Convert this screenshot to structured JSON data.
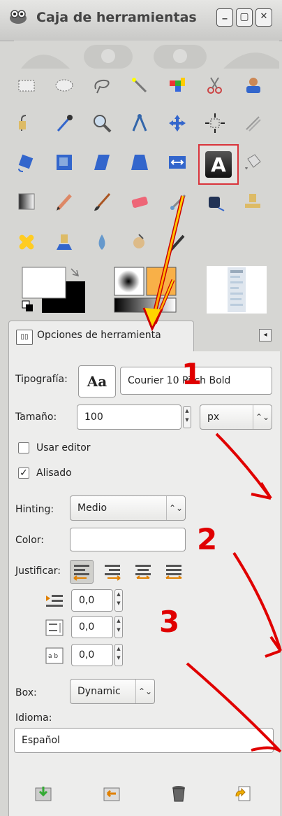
{
  "window": {
    "title": "Caja de herramientas"
  },
  "tab": {
    "label": "Opciones de herramienta"
  },
  "options": {
    "font_label": "Tipografía:",
    "font_button": "Aa",
    "font_value": "Courier 10 Pitch Bold",
    "size_label": "Tamaño:",
    "size_value": "100",
    "unit_value": "px",
    "use_editor_label": "Usar editor",
    "use_editor_checked": false,
    "antialias_label": "Alisado",
    "antialias_checked": true,
    "hinting_label": "Hinting:",
    "hinting_value": "Medio",
    "color_label": "Color:",
    "justify_label": "Justificar:",
    "indent_value": "0,0",
    "line_spacing_value": "0,0",
    "letter_spacing_value": "0,0",
    "box_label": "Box:",
    "box_value": "Dynamic",
    "language_label": "Idioma:",
    "language_value": "Español"
  },
  "annotations": [
    "1",
    "2",
    "3"
  ],
  "colors": {
    "annotation_red": "#e00000",
    "selection_box": "#d9343b",
    "foreground": "#ffffff",
    "background": "#000000",
    "pattern_orange": "#f8b048"
  },
  "icons": {
    "tools": [
      "rect-select-icon",
      "ellipse-select-icon",
      "free-select-icon",
      "fuzzy-select-icon",
      "select-by-color-icon",
      "scissors-icon",
      "foreground-select-icon",
      "paths-icon",
      "color-picker-icon",
      "zoom-icon",
      "measure-icon",
      "move-icon",
      "align-icon",
      "crop-icon",
      "rotate-icon",
      "scale-icon",
      "shear-icon",
      "perspective-icon",
      "flip-icon",
      "text-tool-icon",
      "bucket-fill-icon",
      "blend-icon",
      "pencil-icon",
      "paintbrush-icon",
      "eraser-icon",
      "airbrush-icon",
      "ink-icon",
      "clone-icon",
      "heal-icon",
      "perspective-clone-icon",
      "blur-icon",
      "smudge-icon",
      "dodge-burn-icon"
    ],
    "bottom": [
      "save-options-icon",
      "restore-options-icon",
      "delete-options-icon",
      "reset-options-icon"
    ]
  }
}
